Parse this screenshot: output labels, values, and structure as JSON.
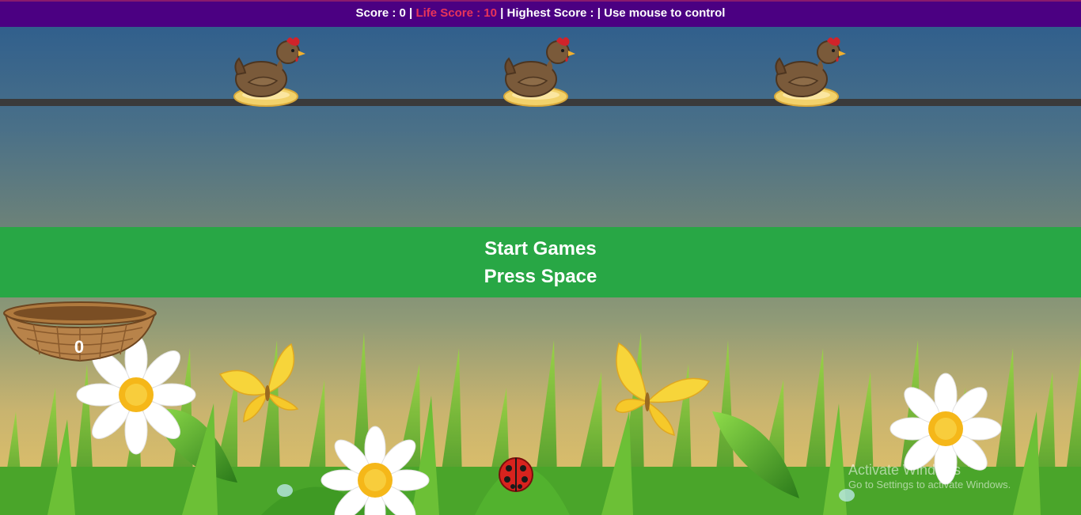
{
  "hud": {
    "score_label": "Score : 0",
    "sep1": " | ",
    "life_label": "Life Score : 10",
    "sep2": " | ",
    "highest_label": "Highest Score :",
    "sep3": " | ",
    "control_hint": "Use mouse to control"
  },
  "banner": {
    "line1": "Start Games",
    "line2": "Press Space"
  },
  "basket": {
    "count": "0"
  },
  "watermark": {
    "line1": "Activate Windows",
    "line2": "Go to Settings to activate Windows."
  },
  "colors": {
    "hud_bg": "#4b0082",
    "life_text": "#e8345a",
    "banner_bg": "#28a745",
    "perch": "#3a3a3a"
  },
  "icons": [
    "hen-icon",
    "basket-icon",
    "daisy-icon",
    "butterfly-icon",
    "ladybug-icon"
  ]
}
